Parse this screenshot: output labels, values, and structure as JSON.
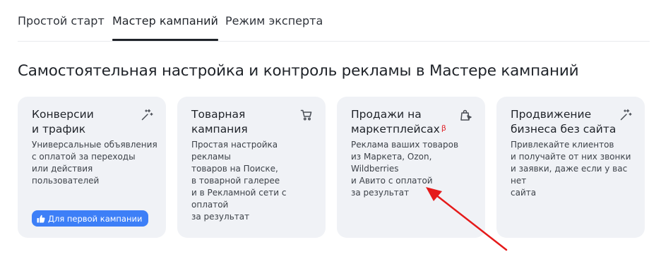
{
  "tabs": [
    {
      "label": "Простой старт"
    },
    {
      "label": "Мастер кампаний",
      "active": true
    },
    {
      "label": "Режим эксперта"
    }
  ],
  "heading": "Самостоятельная настройка и контроль рекламы в Мастере кампаний",
  "cards": [
    {
      "title_line1": "Конверсии",
      "title_line2": "и трафик",
      "desc": [
        "Универсальные объявления",
        "с оплатой за переходы",
        "или действия пользователей"
      ],
      "icon": "magic-wand-icon",
      "badge": "Для первой кампании"
    },
    {
      "title_line1": "Товарная",
      "title_line2": "кампания",
      "desc": [
        "Простая настройка рекламы",
        "товаров на Поиске,",
        "в товарной галерее",
        "и в Рекламной сети с оплатой",
        "за результат"
      ],
      "icon": "cart-icon"
    },
    {
      "title_line1": "Продажи на",
      "title_line2": "маркетплейсах",
      "beta": "β",
      "desc": [
        "Реклама ваших товаров",
        "из Маркета, Ozon, Wildberries",
        "и Авито с оплатой",
        "за результат"
      ],
      "icon": "shopping-bag-icon"
    },
    {
      "title_line1": "Продвижение",
      "title_line2": "бизнеса без сайта",
      "desc": [
        "Привлекайте клиентов",
        "и получайте от них звонки",
        "и заявки, даже если у вас нет",
        "сайта"
      ],
      "icon": "magic-wand-icon"
    }
  ],
  "colors": {
    "accent": "#3d7ff7",
    "card_bg": "#f0f2f6",
    "annotation_arrow": "#e51a1a",
    "beta": "#e0262d"
  }
}
